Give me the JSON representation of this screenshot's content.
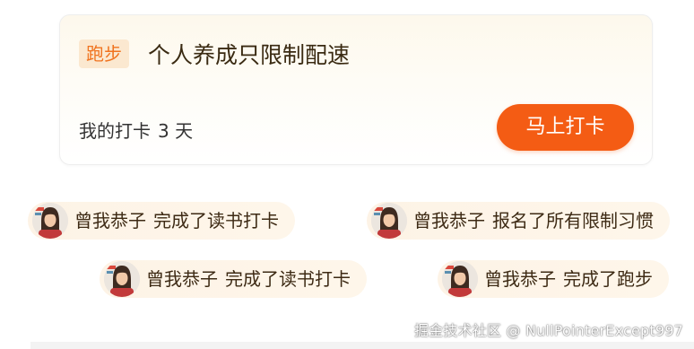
{
  "card": {
    "tag": "跑步",
    "title": "个人养成只限制配速",
    "checkin_label": "我的打卡",
    "checkin_days": "3 天",
    "button_label": "马上打卡"
  },
  "feed": [
    {
      "user": "曾我恭子",
      "action": "完成了读书打卡"
    },
    {
      "user": "曾我恭子",
      "action": "报名了所有限制习惯"
    },
    {
      "user": "曾我恭子",
      "action": "完成了读书打卡"
    },
    {
      "user": "曾我恭子",
      "action": "完成了跑步"
    }
  ],
  "watermark": "掘金技术社区 @ NullPointerExcept997",
  "colors": {
    "accent": "#f45c14",
    "tag_bg": "#fbe8d0",
    "tag_text": "#f0731f",
    "pill_bg": "#fdf3e6"
  }
}
